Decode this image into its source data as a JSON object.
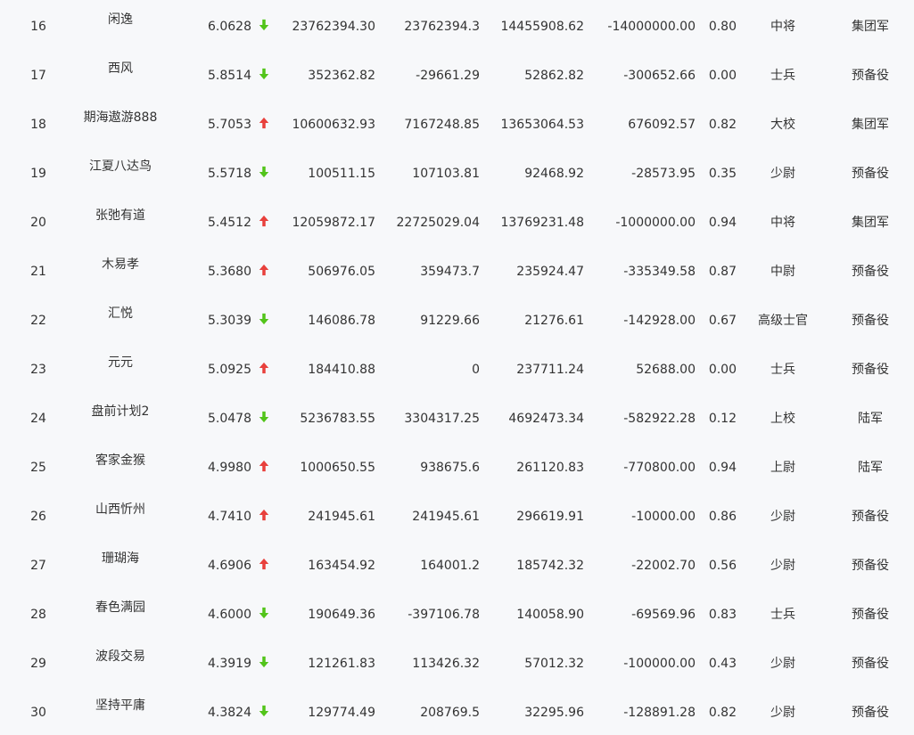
{
  "colors": {
    "up": "#e8403c",
    "down": "#52c41a",
    "text": "#333333",
    "background": "#f7f8fa"
  },
  "rows": [
    {
      "rank": "16",
      "name": "闲逸",
      "score": "6.0628",
      "trend": "down",
      "v1": "23762394.30",
      "v2": "23762394.3",
      "v3": "14455908.62",
      "v4": "-14000000.00",
      "ratio": "0.80",
      "level": "中将",
      "unit": "集团军"
    },
    {
      "rank": "17",
      "name": "西风",
      "score": "5.8514",
      "trend": "down",
      "v1": "352362.82",
      "v2": "-29661.29",
      "v3": "52862.82",
      "v4": "-300652.66",
      "ratio": "0.00",
      "level": "士兵",
      "unit": "预备役"
    },
    {
      "rank": "18",
      "name": "期海遨游888",
      "score": "5.7053",
      "trend": "up",
      "v1": "10600632.93",
      "v2": "7167248.85",
      "v3": "13653064.53",
      "v4": "676092.57",
      "ratio": "0.82",
      "level": "大校",
      "unit": "集团军"
    },
    {
      "rank": "19",
      "name": "江夏八达鸟",
      "score": "5.5718",
      "trend": "down",
      "v1": "100511.15",
      "v2": "107103.81",
      "v3": "92468.92",
      "v4": "-28573.95",
      "ratio": "0.35",
      "level": "少尉",
      "unit": "预备役"
    },
    {
      "rank": "20",
      "name": "张弛有道",
      "score": "5.4512",
      "trend": "up",
      "v1": "12059872.17",
      "v2": "22725029.04",
      "v3": "13769231.48",
      "v4": "-1000000.00",
      "ratio": "0.94",
      "level": "中将",
      "unit": "集团军"
    },
    {
      "rank": "21",
      "name": "木易孝",
      "score": "5.3680",
      "trend": "up",
      "v1": "506976.05",
      "v2": "359473.7",
      "v3": "235924.47",
      "v4": "-335349.58",
      "ratio": "0.87",
      "level": "中尉",
      "unit": "预备役"
    },
    {
      "rank": "22",
      "name": "汇悦",
      "score": "5.3039",
      "trend": "down",
      "v1": "146086.78",
      "v2": "91229.66",
      "v3": "21276.61",
      "v4": "-142928.00",
      "ratio": "0.67",
      "level": "高级士官",
      "unit": "预备役"
    },
    {
      "rank": "23",
      "name": "元元",
      "score": "5.0925",
      "trend": "up",
      "v1": "184410.88",
      "v2": "0",
      "v3": "237711.24",
      "v4": "52688.00",
      "ratio": "0.00",
      "level": "士兵",
      "unit": "预备役"
    },
    {
      "rank": "24",
      "name": "盘前计划2",
      "score": "5.0478",
      "trend": "down",
      "v1": "5236783.55",
      "v2": "3304317.25",
      "v3": "4692473.34",
      "v4": "-582922.28",
      "ratio": "0.12",
      "level": "上校",
      "unit": "陆军"
    },
    {
      "rank": "25",
      "name": "客家金猴",
      "score": "4.9980",
      "trend": "up",
      "v1": "1000650.55",
      "v2": "938675.6",
      "v3": "261120.83",
      "v4": "-770800.00",
      "ratio": "0.94",
      "level": "上尉",
      "unit": "陆军"
    },
    {
      "rank": "26",
      "name": "山西忻州",
      "score": "4.7410",
      "trend": "up",
      "v1": "241945.61",
      "v2": "241945.61",
      "v3": "296619.91",
      "v4": "-10000.00",
      "ratio": "0.86",
      "level": "少尉",
      "unit": "预备役"
    },
    {
      "rank": "27",
      "name": "珊瑚海",
      "score": "4.6906",
      "trend": "up",
      "v1": "163454.92",
      "v2": "164001.2",
      "v3": "185742.32",
      "v4": "-22002.70",
      "ratio": "0.56",
      "level": "少尉",
      "unit": "预备役"
    },
    {
      "rank": "28",
      "name": "春色满园",
      "score": "4.6000",
      "trend": "down",
      "v1": "190649.36",
      "v2": "-397106.78",
      "v3": "140058.90",
      "v4": "-69569.96",
      "ratio": "0.83",
      "level": "士兵",
      "unit": "预备役"
    },
    {
      "rank": "29",
      "name": "波段交易",
      "score": "4.3919",
      "trend": "down",
      "v1": "121261.83",
      "v2": "113426.32",
      "v3": "57012.32",
      "v4": "-100000.00",
      "ratio": "0.43",
      "level": "少尉",
      "unit": "预备役"
    },
    {
      "rank": "30",
      "name": "坚持平庸",
      "score": "4.3824",
      "trend": "down",
      "v1": "129774.49",
      "v2": "208769.5",
      "v3": "32295.96",
      "v4": "-128891.28",
      "ratio": "0.82",
      "level": "少尉",
      "unit": "预备役"
    }
  ]
}
